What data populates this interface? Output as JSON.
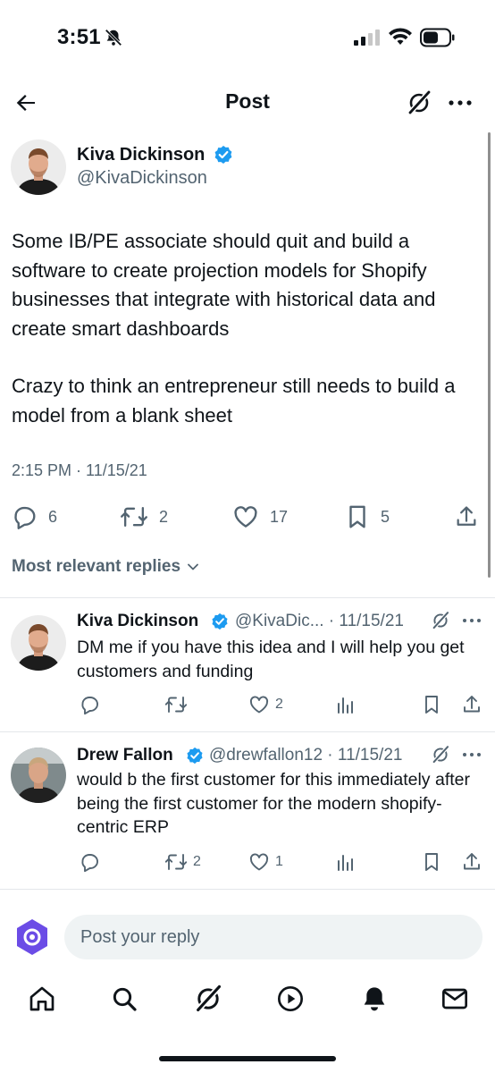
{
  "status_bar": {
    "time": "3:51"
  },
  "header": {
    "title": "Post"
  },
  "tweet": {
    "author_name": "Kiva Dickinson",
    "author_handle": "@KivaDickinson",
    "text_p1": "Some IB/PE associate should quit and build a software to create projection models for Shopify businesses that integrate with historical data and create smart dashboards",
    "text_p2": "Crazy to think an entrepreneur still needs to build a model from a blank sheet",
    "timestamp": "2:15 PM · 11/15/21",
    "replies": "6",
    "reposts": "2",
    "likes": "17",
    "bookmarks": "5"
  },
  "replies_sort_label": "Most relevant replies",
  "replies": [
    {
      "name": "Kiva Dickinson",
      "meta": "@KivaDic... · 11/15/21",
      "text": "DM me if you have this idea and I will help you get customers and funding",
      "retweets": "",
      "likes": "2"
    },
    {
      "name": "Drew Fallon",
      "meta": "@drewfallon12 · 11/15/21",
      "text": "would b the first customer for this immediately after being the first customer for the modern shopify-centric ERP",
      "retweets": "2",
      "likes": "1"
    }
  ],
  "reply_bar": {
    "placeholder": "Post your reply"
  },
  "colors": {
    "accent": "#1d9bf0",
    "text": "#0f1419",
    "muted": "#536471",
    "grok_purple": "#6b4ce6"
  },
  "icons": [
    "back-arrow-icon",
    "grok-icon",
    "more-icon",
    "verified-badge-icon",
    "reply-icon",
    "repost-icon",
    "like-icon",
    "bookmark-icon",
    "share-icon",
    "analytics-icon",
    "home-icon",
    "search-icon",
    "play-icon",
    "notifications-icon",
    "messages-icon"
  ]
}
